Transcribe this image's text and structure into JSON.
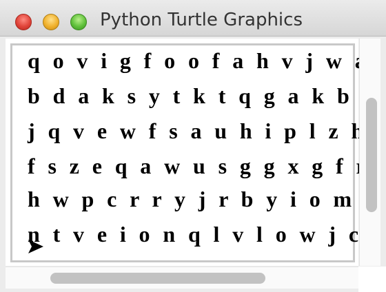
{
  "window": {
    "title": "Python Turtle Graphics"
  },
  "canvas": {
    "rows": [
      "q o v i g f o o f a h v j w a",
      "b d a k s y t k t q g a k b t",
      "j q v e w f s a u h i p l z h",
      "f s z e q a w u s g g x g f r",
      "h w p c r r y j r b y i o m l",
      "n t v e i o n q l v l o w j c"
    ],
    "turtle_icon": "turtle-arrow-icon"
  },
  "colors": {
    "text": "#000000",
    "canvas_border": "#c8c8c8",
    "scrollbar_thumb": "#c2c2c2"
  }
}
